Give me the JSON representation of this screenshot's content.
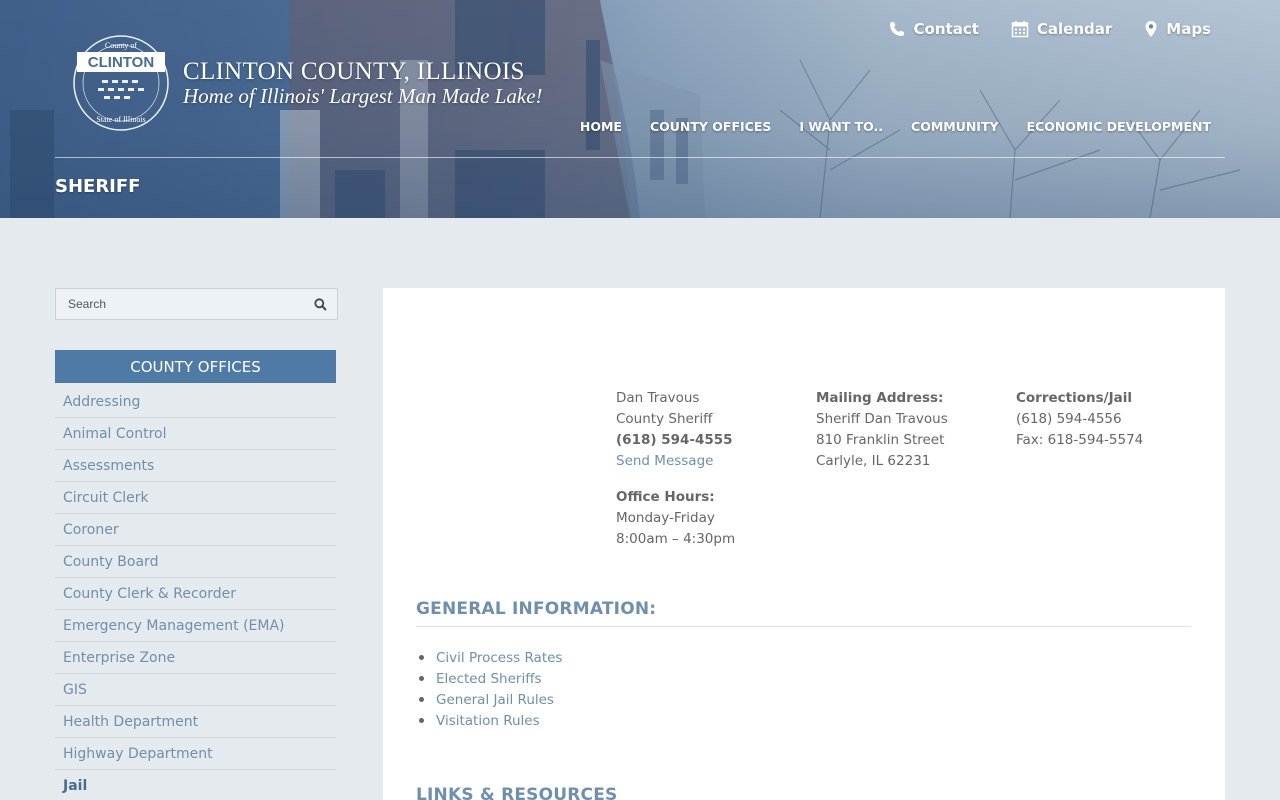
{
  "header": {
    "title": "CLINTON COUNTY, ILLINOIS",
    "tagline": "Home of Illinois' Largest Man Made Lake!",
    "seal": {
      "top_text": "County of",
      "name": "CLINTON",
      "bottom_text": "State of Illinois"
    },
    "page_title": "SHERIFF"
  },
  "utility_nav": [
    {
      "label": "Contact",
      "icon": "phone-icon"
    },
    {
      "label": "Calendar",
      "icon": "calendar-icon"
    },
    {
      "label": "Maps",
      "icon": "map-pin-icon"
    }
  ],
  "main_nav": [
    "HOME",
    "COUNTY OFFICES",
    "I WANT TO..",
    "COMMUNITY",
    "ECONOMIC DEVELOPMENT"
  ],
  "sidebar": {
    "search_placeholder": "Search",
    "heading": "COUNTY OFFICES",
    "items": [
      {
        "label": "Addressing"
      },
      {
        "label": "Animal Control"
      },
      {
        "label": "Assessments"
      },
      {
        "label": "Circuit Clerk"
      },
      {
        "label": "Coroner"
      },
      {
        "label": "County Board"
      },
      {
        "label": "County Clerk & Recorder"
      },
      {
        "label": "Emergency Management (EMA)"
      },
      {
        "label": "Enterprise Zone"
      },
      {
        "label": "GIS"
      },
      {
        "label": "Health Department"
      },
      {
        "label": "Highway Department"
      },
      {
        "label": "Jail",
        "active": true
      }
    ]
  },
  "contact": {
    "sheriff": {
      "name": "Dan Travous",
      "title": "County Sheriff",
      "phone": "(618) 594-4555",
      "message_link": "Send Message"
    },
    "hours": {
      "label": "Office Hours:",
      "days": "Monday-Friday",
      "time": "8:00am – 4:30pm"
    },
    "mailing": {
      "label": "Mailing Address:",
      "line1": "Sheriff Dan Travous",
      "line2": "810 Franklin Street",
      "line3": "Carlyle, IL 62231"
    },
    "corrections": {
      "label": "Corrections/Jail",
      "phone": "(618) 594-4556",
      "fax": "Fax: 618-594-5574"
    }
  },
  "general_info": {
    "heading": "GENERAL INFORMATION:",
    "links": [
      "Civil Process Rates",
      "Elected Sheriffs",
      "General Jail Rules",
      "Visitation Rules"
    ]
  },
  "links_resources": {
    "heading": "LINKS & RESOURCES"
  },
  "colors": {
    "accent": "#4f7aa5",
    "link": "#6f8fac",
    "page_bg": "#e4eaee"
  }
}
